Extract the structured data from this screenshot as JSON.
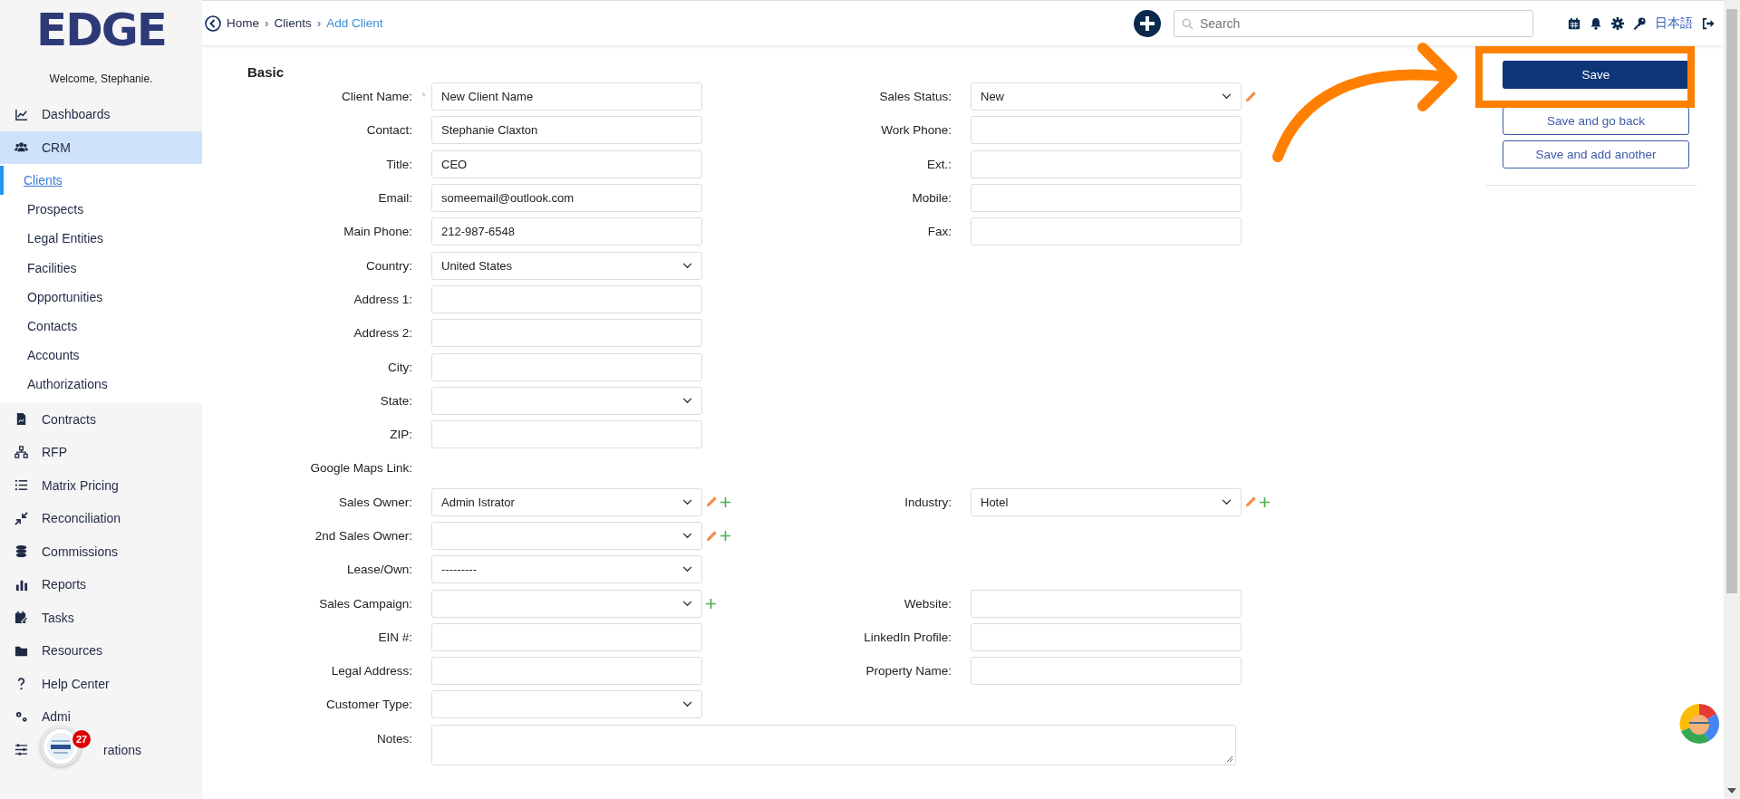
{
  "sidebar": {
    "logo": "EDGE",
    "welcome": "Welcome, Stephanie.",
    "items": [
      {
        "label": "Dashboards",
        "selected": false
      },
      {
        "label": "CRM",
        "selected": true,
        "expanded": true,
        "children": [
          {
            "label": "Clients",
            "selected": true
          },
          {
            "label": "Prospects",
            "selected": false
          },
          {
            "label": "Legal Entities",
            "selected": false
          },
          {
            "label": "Facilities",
            "selected": false
          },
          {
            "label": "Opportunities",
            "selected": false
          },
          {
            "label": "Contacts",
            "selected": false
          },
          {
            "label": "Accounts",
            "selected": false
          },
          {
            "label": "Authorizations",
            "selected": false
          }
        ]
      },
      {
        "label": "Contracts",
        "selected": false
      },
      {
        "label": "RFP",
        "selected": false
      },
      {
        "label": "Matrix Pricing",
        "selected": false
      },
      {
        "label": "Reconciliation",
        "selected": false
      },
      {
        "label": "Commissions",
        "selected": false
      },
      {
        "label": "Reports",
        "selected": false
      },
      {
        "label": "Tasks",
        "selected": false
      },
      {
        "label": "Resources",
        "selected": false
      },
      {
        "label": "Help Center",
        "selected": false
      },
      {
        "label": "Admi",
        "selected": false
      },
      {
        "label": "rations",
        "selected": false
      }
    ]
  },
  "breadcrumbs": {
    "separator": "›",
    "items": [
      {
        "label": "Home",
        "current": false
      },
      {
        "label": "Clients",
        "current": false
      },
      {
        "label": "Add Client",
        "current": true
      }
    ]
  },
  "search": {
    "placeholder": "Search"
  },
  "language": "日本語",
  "section_title": "Basic",
  "form": {
    "required_mark": "*",
    "rows": [
      {
        "left": {
          "label": "Client Name:",
          "required": true,
          "kind": "text",
          "value": "New Client Name",
          "edit": false,
          "add": false
        },
        "right": {
          "label": "Sales Status:",
          "required": false,
          "kind": "select",
          "value": "New",
          "edit": true,
          "add": false
        }
      },
      {
        "left": {
          "label": "Contact:",
          "required": false,
          "kind": "text",
          "value": "Stephanie Claxton",
          "edit": false,
          "add": false
        },
        "right": {
          "label": "Work Phone:",
          "required": false,
          "kind": "text",
          "edit": false,
          "add": false
        }
      },
      {
        "left": {
          "label": "Title:",
          "required": false,
          "kind": "text",
          "value": "CEO",
          "edit": false,
          "add": false
        },
        "right": {
          "label": "Ext.:",
          "required": false,
          "kind": "text",
          "edit": false,
          "add": false
        }
      },
      {
        "left": {
          "label": "Email:",
          "required": false,
          "kind": "text",
          "value": "someemail@outlook.com",
          "edit": false,
          "add": false
        },
        "right": {
          "label": "Mobile:",
          "required": false,
          "kind": "text",
          "edit": false,
          "add": false
        }
      },
      {
        "left": {
          "label": "Main Phone:",
          "required": false,
          "kind": "text",
          "value": "212-987-6548",
          "edit": false,
          "add": false
        },
        "right": {
          "label": "Fax:",
          "required": false,
          "kind": "text",
          "edit": false,
          "add": false
        }
      },
      {
        "left": {
          "label": "Country:",
          "required": false,
          "kind": "select",
          "value": "United States",
          "edit": false,
          "add": false
        }
      },
      {
        "left": {
          "label": "Address 1:",
          "required": false,
          "kind": "text",
          "edit": false,
          "add": false
        }
      },
      {
        "left": {
          "label": "Address 2:",
          "required": false,
          "kind": "text",
          "edit": false,
          "add": false
        }
      },
      {
        "left": {
          "label": "City:",
          "required": false,
          "kind": "text",
          "edit": false,
          "add": false
        }
      },
      {
        "left": {
          "label": "State:",
          "required": false,
          "kind": "select",
          "edit": false,
          "add": false
        }
      },
      {
        "left": {
          "label": "ZIP:",
          "required": false,
          "kind": "text",
          "edit": false,
          "add": false
        }
      },
      {
        "left": {
          "label": "Google Maps Link:",
          "required": false,
          "kind": "none"
        }
      },
      {
        "left": {
          "label": "Sales Owner:",
          "required": false,
          "kind": "select",
          "value": "Admin Istrator",
          "edit": true,
          "add": true
        },
        "right": {
          "label": "Industry:",
          "required": false,
          "kind": "select",
          "value": "Hotel",
          "edit": true,
          "add": true
        }
      },
      {
        "left": {
          "label": "2nd Sales Owner:",
          "required": false,
          "kind": "select",
          "edit": true,
          "add": true
        }
      },
      {
        "left": {
          "label": "Lease/Own:",
          "required": false,
          "kind": "select",
          "value": "---------",
          "edit": false,
          "add": false
        }
      },
      {
        "left": {
          "label": "Sales Campaign:",
          "required": false,
          "kind": "select",
          "edit": false,
          "add": true
        },
        "right": {
          "label": "Website:",
          "required": false,
          "kind": "text",
          "edit": false,
          "add": false
        }
      },
      {
        "left": {
          "label": "EIN #:",
          "required": false,
          "kind": "text",
          "edit": false,
          "add": false
        },
        "right": {
          "label": "LinkedIn Profile:",
          "required": false,
          "kind": "text",
          "edit": false,
          "add": false
        }
      },
      {
        "left": {
          "label": "Legal Address:",
          "required": false,
          "kind": "text",
          "edit": false,
          "add": false
        },
        "right": {
          "label": "Property Name:",
          "required": false,
          "kind": "text",
          "edit": false,
          "add": false
        }
      },
      {
        "left": {
          "label": "Customer Type:",
          "required": false,
          "kind": "select",
          "edit": false,
          "add": false
        }
      },
      {
        "left": {
          "label": "Notes:",
          "required": false,
          "kind": "textarea",
          "edit": false,
          "add": false
        }
      }
    ]
  },
  "actions": [
    {
      "label": "Save",
      "kind": "primary",
      "highlighted": true
    },
    {
      "label": "Save and go back",
      "kind": "outline",
      "highlighted": false
    },
    {
      "label": "Save and add another",
      "kind": "outline",
      "highlighted": false
    }
  ],
  "notification_badge": {
    "count": "27"
  }
}
